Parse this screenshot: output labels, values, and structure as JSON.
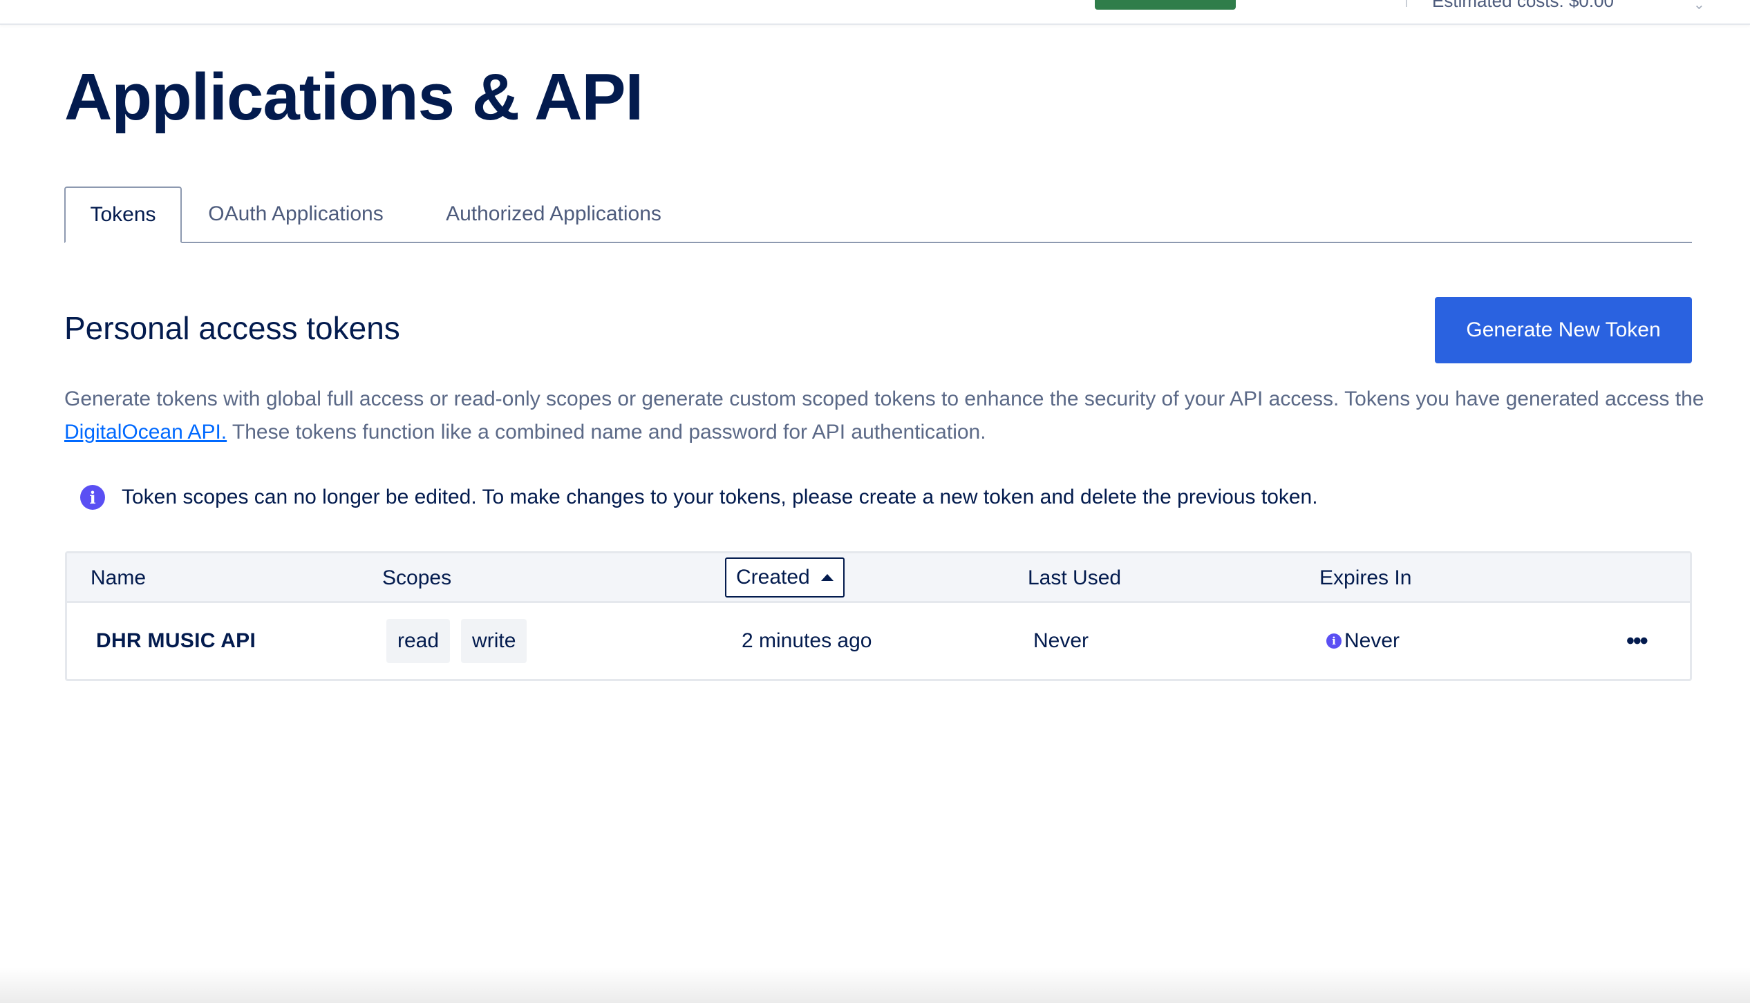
{
  "topbar": {
    "estimated_costs": "Estimated costs: $0.00",
    "chevron_icon": "chevron-down-icon"
  },
  "page": {
    "title": "Applications & API"
  },
  "tabs": [
    {
      "label": "Tokens",
      "active": true
    },
    {
      "label": "OAuth Applications",
      "active": false
    },
    {
      "label": "Authorized Applications",
      "active": false
    }
  ],
  "section": {
    "title": "Personal access tokens",
    "generate_button": "Generate New Token",
    "description_part1": "Generate tokens with global full access or read-only scopes or generate custom scoped tokens to enhance the security of your API access. Tokens you have generated access the ",
    "description_link": "DigitalOcean API.",
    "description_part2": " These tokens function like a combined name and password for API authentication."
  },
  "info_note": {
    "icon": "info-icon",
    "text": "Token scopes can no longer be edited. To make changes to your tokens, please create a new token and delete the previous token."
  },
  "table": {
    "columns": {
      "name": "Name",
      "scopes": "Scopes",
      "created": "Created",
      "last_used": "Last Used",
      "expires_in": "Expires In"
    },
    "sort": {
      "column": "Created",
      "direction": "ascending"
    },
    "rows": [
      {
        "name": "DHR MUSIC API",
        "scopes": [
          "read",
          "write"
        ],
        "created": "2 minutes ago",
        "last_used": "Never",
        "expires_in": "Never"
      }
    ]
  },
  "colors": {
    "primary_button": "#2a62e0",
    "title_text": "#031b4e",
    "info_icon": "#5a4ff3",
    "topbar_green": "#2f7d4a"
  }
}
